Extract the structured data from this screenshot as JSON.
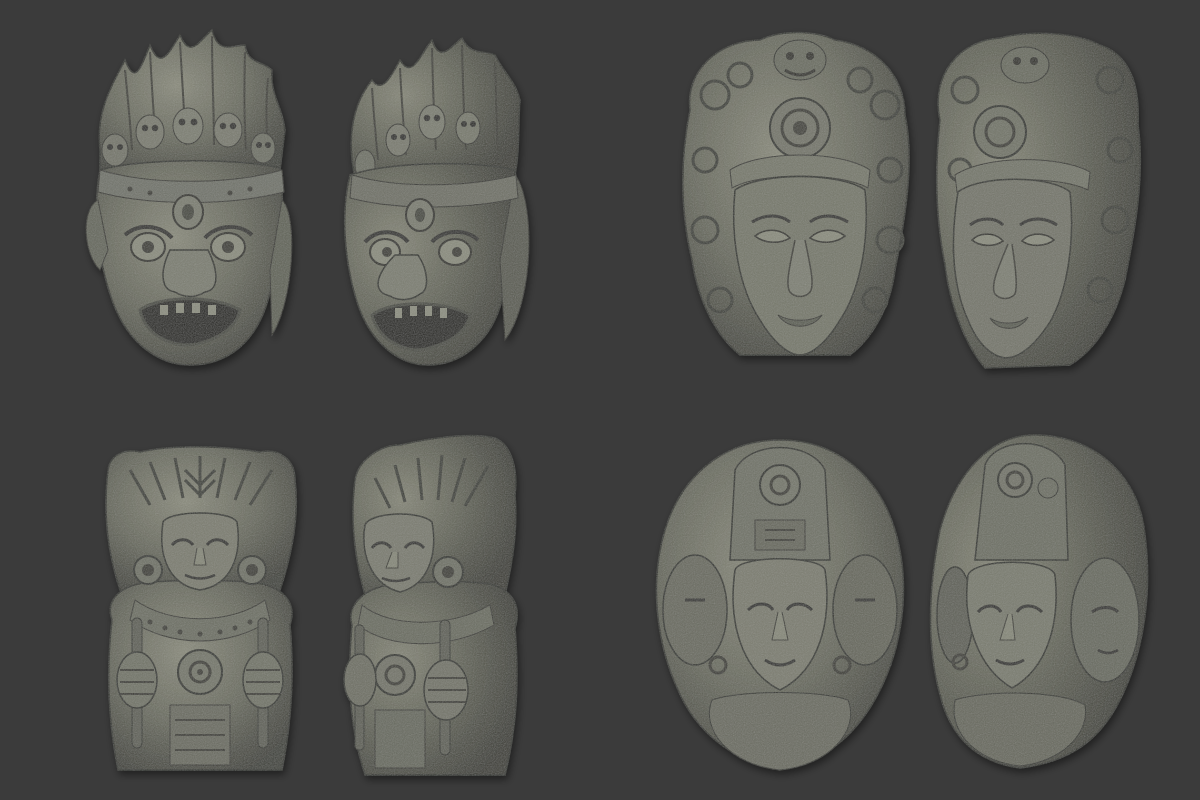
{
  "scene": {
    "background_color": "#3b3b3b",
    "stone_color": "#6d6e62",
    "stone_light": "#878979",
    "stone_dark": "#3a3b33"
  },
  "objects": [
    {
      "name": "wrathful-mask-with-skull-crown",
      "views": [
        "front",
        "three-quarter"
      ]
    },
    {
      "name": "serene-face-with-ornate-diadem",
      "views": [
        "front",
        "three-quarter"
      ]
    },
    {
      "name": "figure-holding-staffs-with-earspools",
      "views": [
        "front",
        "three-quarter"
      ]
    },
    {
      "name": "three-faced-head-bust",
      "views": [
        "front",
        "three-quarter"
      ]
    }
  ]
}
